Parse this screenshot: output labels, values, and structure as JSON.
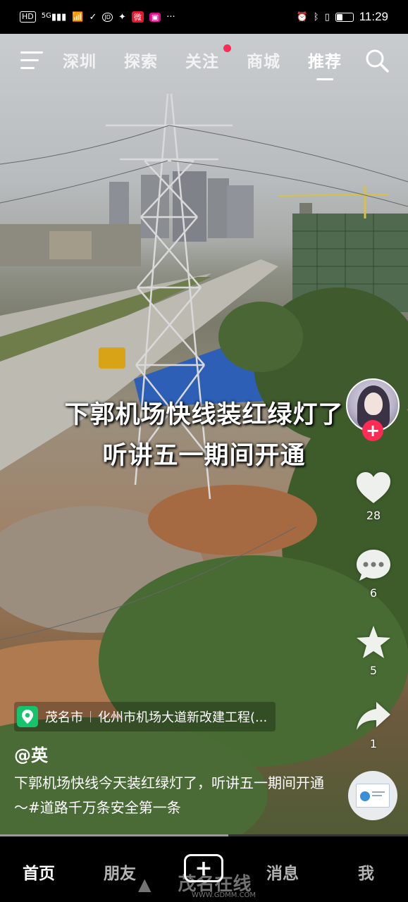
{
  "status_bar": {
    "hd": "HD",
    "net": "5G",
    "time": "11:29",
    "battery_level": 0.4,
    "dots": "···"
  },
  "top_nav": {
    "tabs": [
      "深圳",
      "探索",
      "关注",
      "商城",
      "推荐"
    ],
    "active_tab": "推荐",
    "badge_on": "关注"
  },
  "video": {
    "caption_line1": "下郭机场快线装红绿灯了",
    "caption_line2": "听讲五一期间开通",
    "location_city": "茂名市",
    "location_place": "化州市机场大道新改建工程(...",
    "author": "@英",
    "description": "下郭机场快线今天装红绿灯了，听讲五一期间开通～#道路千万条安全第一条",
    "progress": 0.56
  },
  "actions": {
    "like_count": "28",
    "comment_count": "6",
    "favorite_count": "5",
    "share_count": "1"
  },
  "bottom_nav": {
    "items": [
      "首页",
      "朋友",
      "消息",
      "我"
    ],
    "active": "首页",
    "plus": "+"
  },
  "watermark": {
    "text": "茂名在线",
    "url": "WWW.GDMM.COM"
  },
  "colors": {
    "accent": "#fe2c55",
    "location_pin": "#16c46b"
  }
}
